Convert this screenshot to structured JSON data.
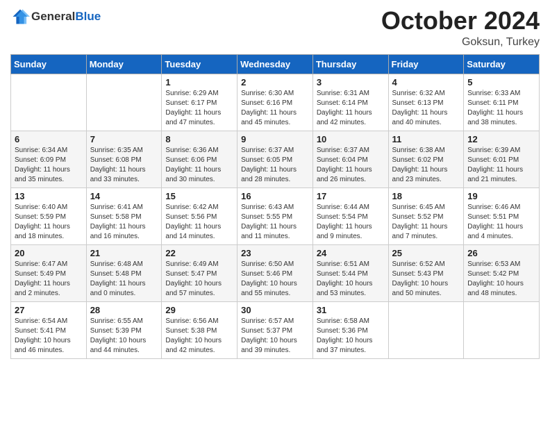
{
  "header": {
    "logo_general": "General",
    "logo_blue": "Blue",
    "month_title": "October 2024",
    "location": "Goksun, Turkey"
  },
  "days_of_week": [
    "Sunday",
    "Monday",
    "Tuesday",
    "Wednesday",
    "Thursday",
    "Friday",
    "Saturday"
  ],
  "weeks": [
    [
      {
        "day": "",
        "sunrise": "",
        "sunset": "",
        "daylight": ""
      },
      {
        "day": "",
        "sunrise": "",
        "sunset": "",
        "daylight": ""
      },
      {
        "day": "1",
        "sunrise": "Sunrise: 6:29 AM",
        "sunset": "Sunset: 6:17 PM",
        "daylight": "Daylight: 11 hours and 47 minutes."
      },
      {
        "day": "2",
        "sunrise": "Sunrise: 6:30 AM",
        "sunset": "Sunset: 6:16 PM",
        "daylight": "Daylight: 11 hours and 45 minutes."
      },
      {
        "day": "3",
        "sunrise": "Sunrise: 6:31 AM",
        "sunset": "Sunset: 6:14 PM",
        "daylight": "Daylight: 11 hours and 42 minutes."
      },
      {
        "day": "4",
        "sunrise": "Sunrise: 6:32 AM",
        "sunset": "Sunset: 6:13 PM",
        "daylight": "Daylight: 11 hours and 40 minutes."
      },
      {
        "day": "5",
        "sunrise": "Sunrise: 6:33 AM",
        "sunset": "Sunset: 6:11 PM",
        "daylight": "Daylight: 11 hours and 38 minutes."
      }
    ],
    [
      {
        "day": "6",
        "sunrise": "Sunrise: 6:34 AM",
        "sunset": "Sunset: 6:09 PM",
        "daylight": "Daylight: 11 hours and 35 minutes."
      },
      {
        "day": "7",
        "sunrise": "Sunrise: 6:35 AM",
        "sunset": "Sunset: 6:08 PM",
        "daylight": "Daylight: 11 hours and 33 minutes."
      },
      {
        "day": "8",
        "sunrise": "Sunrise: 6:36 AM",
        "sunset": "Sunset: 6:06 PM",
        "daylight": "Daylight: 11 hours and 30 minutes."
      },
      {
        "day": "9",
        "sunrise": "Sunrise: 6:37 AM",
        "sunset": "Sunset: 6:05 PM",
        "daylight": "Daylight: 11 hours and 28 minutes."
      },
      {
        "day": "10",
        "sunrise": "Sunrise: 6:37 AM",
        "sunset": "Sunset: 6:04 PM",
        "daylight": "Daylight: 11 hours and 26 minutes."
      },
      {
        "day": "11",
        "sunrise": "Sunrise: 6:38 AM",
        "sunset": "Sunset: 6:02 PM",
        "daylight": "Daylight: 11 hours and 23 minutes."
      },
      {
        "day": "12",
        "sunrise": "Sunrise: 6:39 AM",
        "sunset": "Sunset: 6:01 PM",
        "daylight": "Daylight: 11 hours and 21 minutes."
      }
    ],
    [
      {
        "day": "13",
        "sunrise": "Sunrise: 6:40 AM",
        "sunset": "Sunset: 5:59 PM",
        "daylight": "Daylight: 11 hours and 18 minutes."
      },
      {
        "day": "14",
        "sunrise": "Sunrise: 6:41 AM",
        "sunset": "Sunset: 5:58 PM",
        "daylight": "Daylight: 11 hours and 16 minutes."
      },
      {
        "day": "15",
        "sunrise": "Sunrise: 6:42 AM",
        "sunset": "Sunset: 5:56 PM",
        "daylight": "Daylight: 11 hours and 14 minutes."
      },
      {
        "day": "16",
        "sunrise": "Sunrise: 6:43 AM",
        "sunset": "Sunset: 5:55 PM",
        "daylight": "Daylight: 11 hours and 11 minutes."
      },
      {
        "day": "17",
        "sunrise": "Sunrise: 6:44 AM",
        "sunset": "Sunset: 5:54 PM",
        "daylight": "Daylight: 11 hours and 9 minutes."
      },
      {
        "day": "18",
        "sunrise": "Sunrise: 6:45 AM",
        "sunset": "Sunset: 5:52 PM",
        "daylight": "Daylight: 11 hours and 7 minutes."
      },
      {
        "day": "19",
        "sunrise": "Sunrise: 6:46 AM",
        "sunset": "Sunset: 5:51 PM",
        "daylight": "Daylight: 11 hours and 4 minutes."
      }
    ],
    [
      {
        "day": "20",
        "sunrise": "Sunrise: 6:47 AM",
        "sunset": "Sunset: 5:49 PM",
        "daylight": "Daylight: 11 hours and 2 minutes."
      },
      {
        "day": "21",
        "sunrise": "Sunrise: 6:48 AM",
        "sunset": "Sunset: 5:48 PM",
        "daylight": "Daylight: 11 hours and 0 minutes."
      },
      {
        "day": "22",
        "sunrise": "Sunrise: 6:49 AM",
        "sunset": "Sunset: 5:47 PM",
        "daylight": "Daylight: 10 hours and 57 minutes."
      },
      {
        "day": "23",
        "sunrise": "Sunrise: 6:50 AM",
        "sunset": "Sunset: 5:46 PM",
        "daylight": "Daylight: 10 hours and 55 minutes."
      },
      {
        "day": "24",
        "sunrise": "Sunrise: 6:51 AM",
        "sunset": "Sunset: 5:44 PM",
        "daylight": "Daylight: 10 hours and 53 minutes."
      },
      {
        "day": "25",
        "sunrise": "Sunrise: 6:52 AM",
        "sunset": "Sunset: 5:43 PM",
        "daylight": "Daylight: 10 hours and 50 minutes."
      },
      {
        "day": "26",
        "sunrise": "Sunrise: 6:53 AM",
        "sunset": "Sunset: 5:42 PM",
        "daylight": "Daylight: 10 hours and 48 minutes."
      }
    ],
    [
      {
        "day": "27",
        "sunrise": "Sunrise: 6:54 AM",
        "sunset": "Sunset: 5:41 PM",
        "daylight": "Daylight: 10 hours and 46 minutes."
      },
      {
        "day": "28",
        "sunrise": "Sunrise: 6:55 AM",
        "sunset": "Sunset: 5:39 PM",
        "daylight": "Daylight: 10 hours and 44 minutes."
      },
      {
        "day": "29",
        "sunrise": "Sunrise: 6:56 AM",
        "sunset": "Sunset: 5:38 PM",
        "daylight": "Daylight: 10 hours and 42 minutes."
      },
      {
        "day": "30",
        "sunrise": "Sunrise: 6:57 AM",
        "sunset": "Sunset: 5:37 PM",
        "daylight": "Daylight: 10 hours and 39 minutes."
      },
      {
        "day": "31",
        "sunrise": "Sunrise: 6:58 AM",
        "sunset": "Sunset: 5:36 PM",
        "daylight": "Daylight: 10 hours and 37 minutes."
      },
      {
        "day": "",
        "sunrise": "",
        "sunset": "",
        "daylight": ""
      },
      {
        "day": "",
        "sunrise": "",
        "sunset": "",
        "daylight": ""
      }
    ]
  ]
}
